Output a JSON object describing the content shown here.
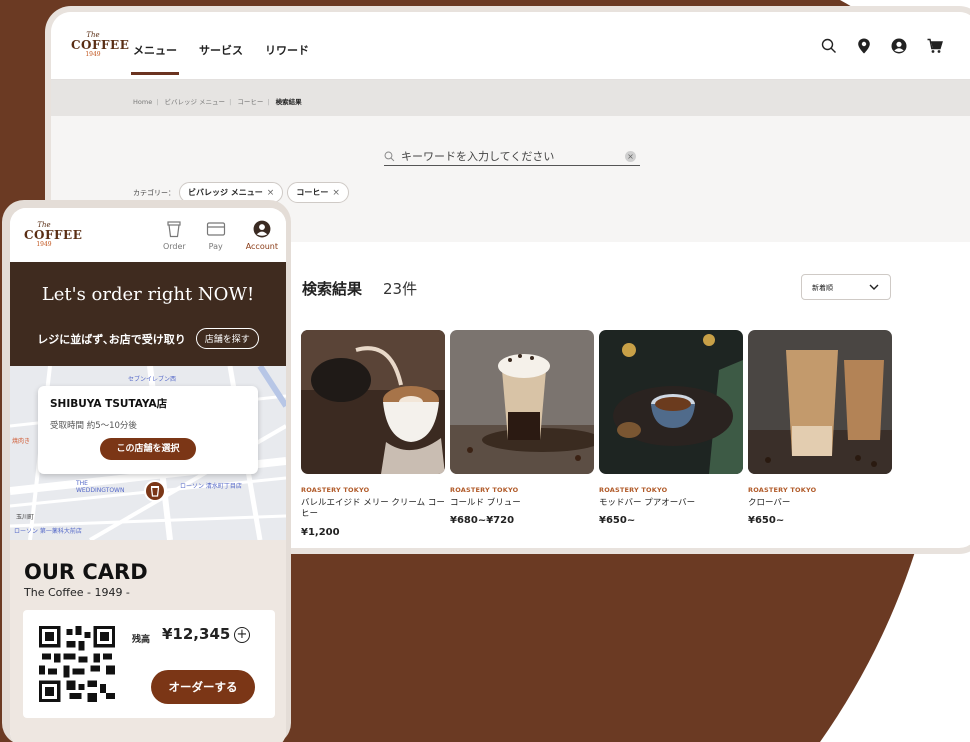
{
  "brand": {
    "the": "The",
    "coffee": "COFFEE",
    "year": "1949"
  },
  "header": {
    "nav": [
      "メニュー",
      "サービス",
      "リワード"
    ],
    "icons": [
      "search-icon",
      "location-pin-icon",
      "account-icon",
      "cart-icon"
    ]
  },
  "breadcrumb": {
    "items": [
      "Home",
      "ビバレッジ メニュー",
      "コーヒー"
    ],
    "current": "検索結果"
  },
  "search": {
    "placeholder": "キーワードを入力してください"
  },
  "filters": {
    "label": "カテゴリー：",
    "chips": [
      "ビバレッジ メニュー",
      "コーヒー"
    ]
  },
  "results": {
    "title": "検索結果",
    "count": "23件",
    "sort": "新着順"
  },
  "products": [
    {
      "brand": "ROASTERY TOKYO",
      "name": "バレルエイジド メリー クリーム コーヒー",
      "price": "¥1,200"
    },
    {
      "brand": "ROASTERY TOKYO",
      "name": "コールド ブリュー",
      "price": "¥680~¥720"
    },
    {
      "brand": "ROASTERY TOKYO",
      "name": "モッドバー プアオーバー",
      "price": "¥650~"
    },
    {
      "brand": "ROASTERY TOKYO",
      "name": "クローバー",
      "price": "¥650~"
    }
  ],
  "mobile": {
    "tabs": [
      "Order",
      "Pay",
      "Account"
    ],
    "hero_title": "Let's order right NOW!",
    "hero_sub": "レジに並ばず､お店で受け取り",
    "store_button": "店舗を探す",
    "store": {
      "name": "SHIBUYA TSUTAYA店",
      "time": "受取時間 約5〜10分後",
      "select": "この店舗を選択"
    },
    "map_labels": [
      "セブンイレブン西",
      "ローソン 渋谷",
      "THE WEDDINGTOWN",
      "ローソン 清水町丁目店",
      "玉川町",
      "ローソン 第一薬科大前店",
      "焼肉き"
    ],
    "card_title": "OUR CARD",
    "card_sub": "The Coffee - 1949 -",
    "balance_label": "残高",
    "balance": "¥12,345",
    "order_button": "オーダーする"
  },
  "colors": {
    "brand_brown": "#7b3616",
    "hero_dark": "#3f2b1f",
    "background": "#6b3a23"
  }
}
